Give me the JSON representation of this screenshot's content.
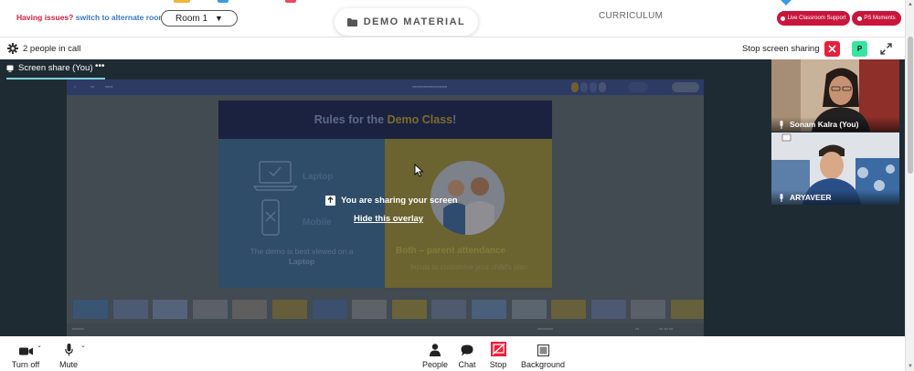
{
  "topbar": {
    "issue_question": "Having issues?",
    "issue_link": "switch to alternate room",
    "room_value": "Room 1",
    "demo_label": "DEMO MATERIAL",
    "curriculum_label": "CURRICULUM",
    "support_label": "Live Classroom Support",
    "moments_label": "PS Moments"
  },
  "call": {
    "people_count": "2 people in call",
    "stop_share_label": "Stop screen sharing",
    "participant_badge": "P"
  },
  "share": {
    "tab_label": "Screen share (You)",
    "tab_more": "•••",
    "overlay_message": "You are sharing your screen",
    "overlay_hide": "Hide this overlay"
  },
  "slide": {
    "title_plain": "Rules for the ",
    "title_accent": "Demo Class",
    "title_end": "!",
    "laptop": "Laptop",
    "mobile": "Mobile",
    "note_pre": "The demo is best viewed on a ",
    "note_bold": "Laptop",
    "both": "Both – parent attendance",
    "inputs": "Inputs to customise your child's plan"
  },
  "participants": [
    {
      "name": "Sonam Kalra (You)"
    },
    {
      "name": "ARYAVEER"
    }
  ],
  "controls": {
    "turn_off": "Turn off",
    "mute": "Mute",
    "people": "People",
    "chat": "Chat",
    "stop": "Stop",
    "background": "Background"
  },
  "colors": {
    "brand_red": "#c8173c",
    "stop_red": "#e8213b",
    "badge_green": "#37e5a0",
    "tab_accent": "#7fd1d6",
    "stage_bg": "#1f2b33"
  }
}
